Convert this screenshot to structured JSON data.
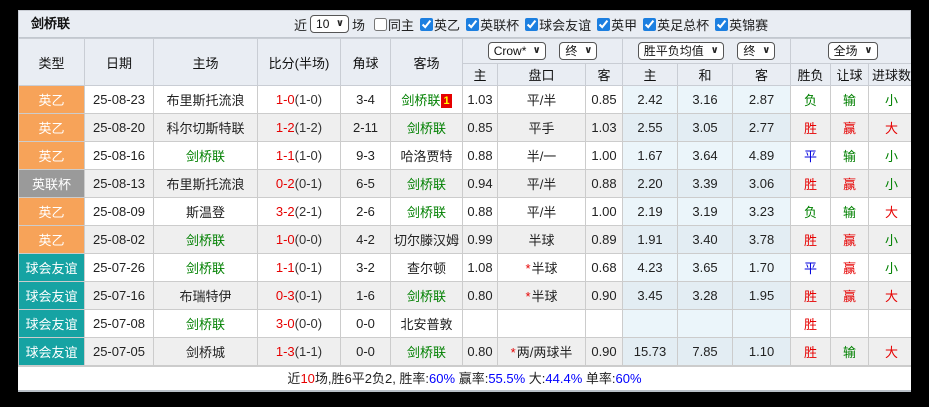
{
  "title": "剑桥联",
  "filter": {
    "near_label": "近",
    "games_value": "10",
    "games_label": "场",
    "checkboxes": [
      {
        "label": "同主",
        "checked": false
      },
      {
        "label": "英乙",
        "checked": true
      },
      {
        "label": "英联杯",
        "checked": true
      },
      {
        "label": "球会友谊",
        "checked": true
      },
      {
        "label": "英甲",
        "checked": true
      },
      {
        "label": "英足总杯",
        "checked": true
      },
      {
        "label": "英锦赛",
        "checked": true
      }
    ]
  },
  "selects": {
    "odds_source": "Crow*",
    "odds_final": "终",
    "avg_source": "胜平负均值",
    "avg_final": "终",
    "scope": "全场"
  },
  "columns": {
    "type": "类型",
    "date": "日期",
    "home": "主场",
    "score": "比分(半场)",
    "corners": "角球",
    "away": "客场",
    "odds_home": "主",
    "handicap": "盘口",
    "odds_away": "客",
    "avg_home": "主",
    "avg_draw": "和",
    "avg_away": "客",
    "result": "胜负",
    "handicap_result": "让球",
    "goals": "进球数"
  },
  "type_colors": {
    "英乙": "#f7a359",
    "英联杯": "#9a9a9a",
    "球会友谊": "#16a3a3"
  },
  "outcome_colors": {
    "胜": "#e60000",
    "平": "#0000dd",
    "负": "#008000",
    "赢": "#e60000",
    "输": "#008000",
    "大": "#e60000",
    "小": "#008000"
  },
  "rows": [
    {
      "type": "英乙",
      "date": "25-08-23",
      "home": "布里斯托流浪",
      "home_target": false,
      "score": "1-0",
      "half": "(1-0)",
      "corners": "3-4",
      "away": "剑桥联",
      "away_target": true,
      "away_badge": "1",
      "odds_home": "1.03",
      "handicap_star": "",
      "handicap": "平/半",
      "odds_away": "0.85",
      "avg_home": "2.42",
      "avg_draw": "3.16",
      "avg_away": "2.87",
      "result": "负",
      "handicap_result": "输",
      "goals": "小"
    },
    {
      "type": "英乙",
      "date": "25-08-20",
      "home": "科尔切斯特联",
      "home_target": false,
      "score": "1-2",
      "half": "(1-2)",
      "corners": "2-11",
      "away": "剑桥联",
      "away_target": true,
      "away_badge": "",
      "odds_home": "0.85",
      "handicap_star": "",
      "handicap": "平手",
      "odds_away": "1.03",
      "avg_home": "2.55",
      "avg_draw": "3.05",
      "avg_away": "2.77",
      "result": "胜",
      "handicap_result": "赢",
      "goals": "大"
    },
    {
      "type": "英乙",
      "date": "25-08-16",
      "home": "剑桥联",
      "home_target": true,
      "score": "1-1",
      "half": "(1-0)",
      "corners": "9-3",
      "away": "哈洛贾特",
      "away_target": false,
      "away_badge": "",
      "odds_home": "0.88",
      "handicap_star": "",
      "handicap": "半/一",
      "odds_away": "1.00",
      "avg_home": "1.67",
      "avg_draw": "3.64",
      "avg_away": "4.89",
      "result": "平",
      "handicap_result": "输",
      "goals": "小"
    },
    {
      "type": "英联杯",
      "date": "25-08-13",
      "home": "布里斯托流浪",
      "home_target": false,
      "score": "0-2",
      "half": "(0-1)",
      "corners": "6-5",
      "away": "剑桥联",
      "away_target": true,
      "away_badge": "",
      "odds_home": "0.94",
      "handicap_star": "",
      "handicap": "平/半",
      "odds_away": "0.88",
      "avg_home": "2.20",
      "avg_draw": "3.39",
      "avg_away": "3.06",
      "result": "胜",
      "handicap_result": "赢",
      "goals": "小"
    },
    {
      "type": "英乙",
      "date": "25-08-09",
      "home": "斯温登",
      "home_target": false,
      "score": "3-2",
      "half": "(2-1)",
      "corners": "2-6",
      "away": "剑桥联",
      "away_target": true,
      "away_badge": "",
      "odds_home": "0.88",
      "handicap_star": "",
      "handicap": "平/半",
      "odds_away": "1.00",
      "avg_home": "2.19",
      "avg_draw": "3.19",
      "avg_away": "3.23",
      "result": "负",
      "handicap_result": "输",
      "goals": "大"
    },
    {
      "type": "英乙",
      "date": "25-08-02",
      "home": "剑桥联",
      "home_target": true,
      "score": "1-0",
      "half": "(0-0)",
      "corners": "4-2",
      "away": "切尔滕汉姆",
      "away_target": false,
      "away_badge": "",
      "odds_home": "0.99",
      "handicap_star": "",
      "handicap": "半球",
      "odds_away": "0.89",
      "avg_home": "1.91",
      "avg_draw": "3.40",
      "avg_away": "3.78",
      "result": "胜",
      "handicap_result": "赢",
      "goals": "小"
    },
    {
      "type": "球会友谊",
      "date": "25-07-26",
      "home": "剑桥联",
      "home_target": true,
      "score": "1-1",
      "half": "(0-1)",
      "corners": "3-2",
      "away": "查尔顿",
      "away_target": false,
      "away_badge": "",
      "odds_home": "1.08",
      "handicap_star": "*",
      "handicap": "半球",
      "odds_away": "0.68",
      "avg_home": "4.23",
      "avg_draw": "3.65",
      "avg_away": "1.70",
      "result": "平",
      "handicap_result": "赢",
      "goals": "小"
    },
    {
      "type": "球会友谊",
      "date": "25-07-16",
      "home": "布瑞特伊",
      "home_target": false,
      "score": "0-3",
      "half": "(0-1)",
      "corners": "1-6",
      "away": "剑桥联",
      "away_target": true,
      "away_badge": "",
      "odds_home": "0.80",
      "handicap_star": "*",
      "handicap": "半球",
      "odds_away": "0.90",
      "avg_home": "3.45",
      "avg_draw": "3.28",
      "avg_away": "1.95",
      "result": "胜",
      "handicap_result": "赢",
      "goals": "大"
    },
    {
      "type": "球会友谊",
      "date": "25-07-08",
      "home": "剑桥联",
      "home_target": true,
      "score": "3-0",
      "half": "(0-0)",
      "corners": "0-0",
      "away": "北安普敦",
      "away_target": false,
      "away_badge": "",
      "odds_home": "",
      "handicap_star": "",
      "handicap": "",
      "odds_away": "",
      "avg_home": "",
      "avg_draw": "",
      "avg_away": "",
      "result": "胜",
      "handicap_result": "",
      "goals": ""
    },
    {
      "type": "球会友谊",
      "date": "25-07-05",
      "home": "剑桥城",
      "home_target": false,
      "score": "1-3",
      "half": "(1-1)",
      "corners": "0-0",
      "away": "剑桥联",
      "away_target": true,
      "away_badge": "",
      "odds_home": "0.80",
      "handicap_star": "*",
      "handicap": "两/两球半",
      "odds_away": "0.90",
      "avg_home": "15.73",
      "avg_draw": "7.85",
      "avg_away": "1.10",
      "result": "胜",
      "handicap_result": "输",
      "goals": "大"
    }
  ],
  "summary": [
    {
      "text": "近",
      "color": "#222222"
    },
    {
      "text": "10",
      "color": "#e60000"
    },
    {
      "text": "场,胜6平2负2, 胜率:",
      "color": "#222222"
    },
    {
      "text": "60%",
      "color": "#0000ff"
    },
    {
      "text": " 赢率:",
      "color": "#222222"
    },
    {
      "text": "55.5%",
      "color": "#0000ff"
    },
    {
      "text": " 大:",
      "color": "#222222"
    },
    {
      "text": "44.4%",
      "color": "#0000ff"
    },
    {
      "text": " 单率:",
      "color": "#222222"
    },
    {
      "text": "60%",
      "color": "#0000ff"
    }
  ]
}
